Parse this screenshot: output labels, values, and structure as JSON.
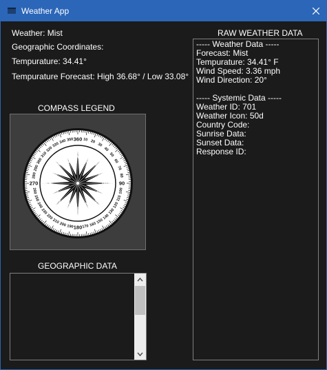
{
  "window": {
    "title": "Weather App"
  },
  "labels": {
    "weather": "Weather: Mist",
    "coordinates": "Geographic Coordinates:",
    "temperature": "Tempurature: 34.41°",
    "forecast": "Tempurature Forecast: High 36.68° / Low 33.08°"
  },
  "compass": {
    "title": "COMPASS LEGEND",
    "cardinals": [
      "N",
      "NNE",
      "NE",
      "ENE",
      "E",
      "ESE",
      "SE",
      "SSE",
      "S",
      "SSW",
      "SW",
      "WSW",
      "W",
      "WNW",
      "NW",
      "NNW"
    ],
    "degree_labels": [
      "360",
      "10",
      "20",
      "30",
      "40",
      "50",
      "60",
      "70",
      "80",
      "90",
      "100",
      "110",
      "120",
      "130",
      "140",
      "150",
      "160",
      "170",
      "180",
      "190",
      "200",
      "210",
      "220",
      "230",
      "240",
      "250",
      "260",
      "270",
      "280",
      "290",
      "300",
      "310",
      "320",
      "330",
      "340",
      "350"
    ]
  },
  "geo": {
    "title": "GEOGRAPHIC DATA",
    "value": ""
  },
  "raw": {
    "title": "RAW WEATHER DATA",
    "lines": [
      "----- Weather Data -----",
      "Forecast: Mist",
      "Tempurature: 34.41° F",
      "Wind Speed: 3.36 mph",
      "Wind Direction: 20°",
      "",
      "----- Systemic Data -----",
      "Weather ID: 701",
      "Weather Icon: 50d",
      "Country Code:",
      "Sunrise Data:",
      "Sunset Data:",
      "Response ID:"
    ]
  },
  "icons": {
    "app": "window-icon",
    "close": "close-icon",
    "up": "chevron-up-icon",
    "down": "chevron-down-icon"
  },
  "colors": {
    "titlebar": "#2b66b8",
    "background": "#1b1b1b",
    "panel": "#3d3d3d"
  }
}
